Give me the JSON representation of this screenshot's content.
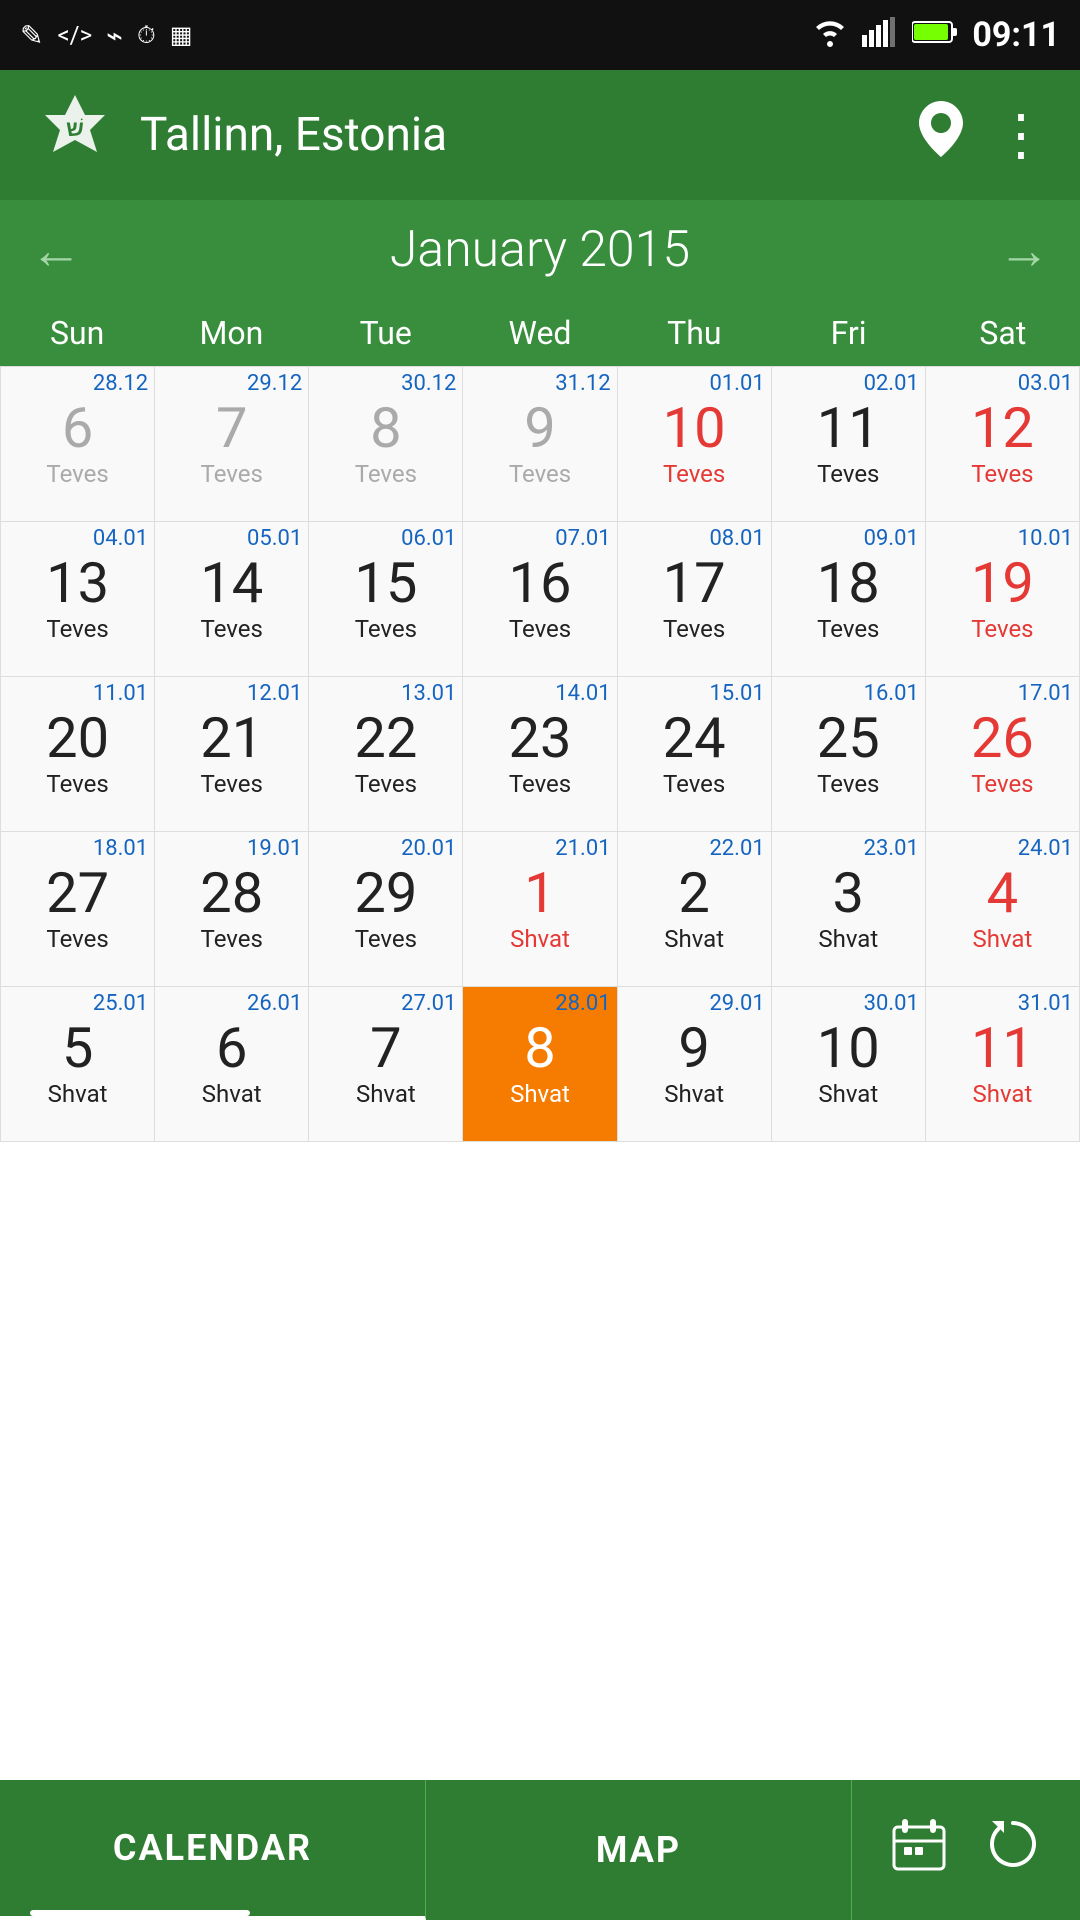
{
  "statusBar": {
    "time": "09:11",
    "leftIcons": [
      "✎",
      "⟨/⟩",
      "⌁",
      "⏱",
      "▦"
    ],
    "rightIcons": [
      "wifi",
      "signal",
      "battery"
    ]
  },
  "header": {
    "title": "Tallinn, Estonia",
    "locationIcon": "📍",
    "moreIcon": "⋮"
  },
  "monthNav": {
    "prevLabel": "←",
    "nextLabel": "→",
    "monthTitle": "January 2015"
  },
  "dayHeaders": [
    "Sun",
    "Mon",
    "Tue",
    "Wed",
    "Thu",
    "Fri",
    "Sat"
  ],
  "calendar": {
    "weeks": [
      [
        {
          "dateSmall": "28.12",
          "dayNum": "6",
          "hebrew": "Teves",
          "numColor": "gray",
          "hebColor": "gray",
          "dateColor": "blue"
        },
        {
          "dateSmall": "29.12",
          "dayNum": "7",
          "hebrew": "Teves",
          "numColor": "gray",
          "hebColor": "gray",
          "dateColor": "blue"
        },
        {
          "dateSmall": "30.12",
          "dayNum": "8",
          "hebrew": "Teves",
          "numColor": "gray",
          "hebColor": "gray",
          "dateColor": "blue"
        },
        {
          "dateSmall": "31.12",
          "dayNum": "9",
          "hebrew": "Teves",
          "numColor": "gray",
          "hebColor": "gray",
          "dateColor": "blue"
        },
        {
          "dateSmall": "01.01",
          "dayNum": "10",
          "hebrew": "Teves",
          "numColor": "red",
          "hebColor": "red",
          "dateColor": "blue"
        },
        {
          "dateSmall": "02.01",
          "dayNum": "11",
          "hebrew": "Teves",
          "numColor": "normal",
          "hebColor": "normal",
          "dateColor": "blue"
        },
        {
          "dateSmall": "03.01",
          "dayNum": "12",
          "hebrew": "Teves",
          "numColor": "red",
          "hebColor": "red",
          "dateColor": "blue"
        }
      ],
      [
        {
          "dateSmall": "04.01",
          "dayNum": "13",
          "hebrew": "Teves",
          "numColor": "normal",
          "hebColor": "normal",
          "dateColor": "blue"
        },
        {
          "dateSmall": "05.01",
          "dayNum": "14",
          "hebrew": "Teves",
          "numColor": "normal",
          "hebColor": "normal",
          "dateColor": "blue"
        },
        {
          "dateSmall": "06.01",
          "dayNum": "15",
          "hebrew": "Teves",
          "numColor": "normal",
          "hebColor": "normal",
          "dateColor": "blue"
        },
        {
          "dateSmall": "07.01",
          "dayNum": "16",
          "hebrew": "Teves",
          "numColor": "normal",
          "hebColor": "normal",
          "dateColor": "blue"
        },
        {
          "dateSmall": "08.01",
          "dayNum": "17",
          "hebrew": "Teves",
          "numColor": "normal",
          "hebColor": "normal",
          "dateColor": "blue"
        },
        {
          "dateSmall": "09.01",
          "dayNum": "18",
          "hebrew": "Teves",
          "numColor": "normal",
          "hebColor": "normal",
          "dateColor": "blue"
        },
        {
          "dateSmall": "10.01",
          "dayNum": "19",
          "hebrew": "Teves",
          "numColor": "red",
          "hebColor": "red",
          "dateColor": "blue"
        }
      ],
      [
        {
          "dateSmall": "11.01",
          "dayNum": "20",
          "hebrew": "Teves",
          "numColor": "normal",
          "hebColor": "normal",
          "dateColor": "blue"
        },
        {
          "dateSmall": "12.01",
          "dayNum": "21",
          "hebrew": "Teves",
          "numColor": "normal",
          "hebColor": "normal",
          "dateColor": "blue"
        },
        {
          "dateSmall": "13.01",
          "dayNum": "22",
          "hebrew": "Teves",
          "numColor": "normal",
          "hebColor": "normal",
          "dateColor": "blue"
        },
        {
          "dateSmall": "14.01",
          "dayNum": "23",
          "hebrew": "Teves",
          "numColor": "normal",
          "hebColor": "normal",
          "dateColor": "blue"
        },
        {
          "dateSmall": "15.01",
          "dayNum": "24",
          "hebrew": "Teves",
          "numColor": "normal",
          "hebColor": "normal",
          "dateColor": "blue"
        },
        {
          "dateSmall": "16.01",
          "dayNum": "25",
          "hebrew": "Teves",
          "numColor": "normal",
          "hebColor": "normal",
          "dateColor": "blue"
        },
        {
          "dateSmall": "17.01",
          "dayNum": "26",
          "hebrew": "Teves",
          "numColor": "red",
          "hebColor": "red",
          "dateColor": "blue"
        }
      ],
      [
        {
          "dateSmall": "18.01",
          "dayNum": "27",
          "hebrew": "Teves",
          "numColor": "normal",
          "hebColor": "normal",
          "dateColor": "blue"
        },
        {
          "dateSmall": "19.01",
          "dayNum": "28",
          "hebrew": "Teves",
          "numColor": "normal",
          "hebColor": "normal",
          "dateColor": "blue"
        },
        {
          "dateSmall": "20.01",
          "dayNum": "29",
          "hebrew": "Teves",
          "numColor": "normal",
          "hebColor": "normal",
          "dateColor": "blue"
        },
        {
          "dateSmall": "21.01",
          "dayNum": "1",
          "hebrew": "Shvat",
          "numColor": "red",
          "hebColor": "red",
          "dateColor": "blue"
        },
        {
          "dateSmall": "22.01",
          "dayNum": "2",
          "hebrew": "Shvat",
          "numColor": "normal",
          "hebColor": "normal",
          "dateColor": "blue"
        },
        {
          "dateSmall": "23.01",
          "dayNum": "3",
          "hebrew": "Shvat",
          "numColor": "normal",
          "hebColor": "normal",
          "dateColor": "blue"
        },
        {
          "dateSmall": "24.01",
          "dayNum": "4",
          "hebrew": "Shvat",
          "numColor": "red",
          "hebColor": "red",
          "dateColor": "blue"
        }
      ],
      [
        {
          "dateSmall": "25.01",
          "dayNum": "5",
          "hebrew": "Shvat",
          "numColor": "normal",
          "hebColor": "normal",
          "dateColor": "blue"
        },
        {
          "dateSmall": "26.01",
          "dayNum": "6",
          "hebrew": "Shvat",
          "numColor": "normal",
          "hebColor": "normal",
          "dateColor": "blue"
        },
        {
          "dateSmall": "27.01",
          "dayNum": "7",
          "hebrew": "Shvat",
          "numColor": "normal",
          "hebColor": "normal",
          "dateColor": "blue"
        },
        {
          "dateSmall": "28.01",
          "dayNum": "8",
          "hebrew": "Shvat",
          "numColor": "orange",
          "hebColor": "orange",
          "dateColor": "blue",
          "today": true
        },
        {
          "dateSmall": "29.01",
          "dayNum": "9",
          "hebrew": "Shvat",
          "numColor": "normal",
          "hebColor": "normal",
          "dateColor": "blue"
        },
        {
          "dateSmall": "30.01",
          "dayNum": "10",
          "hebrew": "Shvat",
          "numColor": "normal",
          "hebColor": "normal",
          "dateColor": "blue"
        },
        {
          "dateSmall": "31.01",
          "dayNum": "11",
          "hebrew": "Shvat",
          "numColor": "red",
          "hebColor": "red",
          "dateColor": "blue"
        }
      ]
    ]
  },
  "bottomNav": {
    "tab1": "CALENDAR",
    "tab2": "MAP",
    "calendarIcon": "📅",
    "refreshIcon": "↻"
  }
}
